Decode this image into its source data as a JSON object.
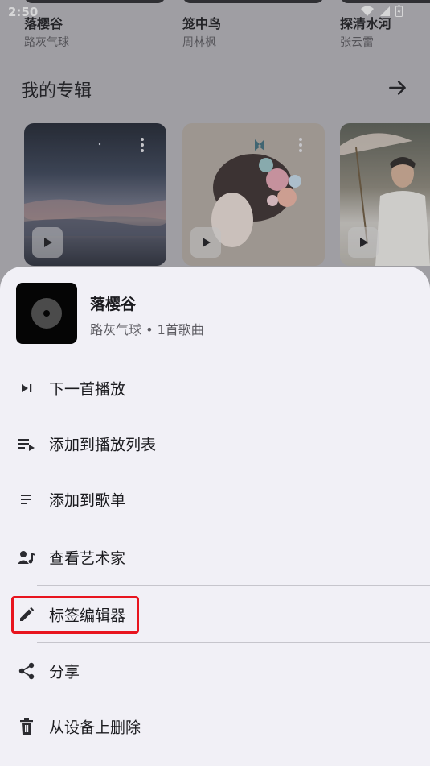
{
  "status_bar": {
    "time": "2:50"
  },
  "top_row": [
    {
      "title": "落樱谷",
      "subtitle": "路灰气球"
    },
    {
      "title": "笼中鸟",
      "subtitle": "周林枫"
    },
    {
      "title": "探清水河",
      "subtitle": "张云雷"
    }
  ],
  "section": {
    "title": "我的专辑"
  },
  "sheet": {
    "title": "落樱谷",
    "subtitle": "路灰气球 • 1首歌曲",
    "menu": [
      {
        "label": "下一首播放",
        "icon": "play-next-icon"
      },
      {
        "label": "添加到播放列表",
        "icon": "queue-add-icon"
      },
      {
        "label": "添加到歌单",
        "icon": "playlist-add-icon"
      },
      {
        "label": "查看艺术家",
        "icon": "artist-icon"
      },
      {
        "label": "标签编辑器",
        "icon": "edit-pencil-icon"
      },
      {
        "label": "分享",
        "icon": "share-icon"
      },
      {
        "label": "从设备上删除",
        "icon": "delete-icon"
      }
    ]
  },
  "colors": {
    "highlight": "#e8141e",
    "sheet_bg": "#f1f0f6",
    "scrim": "#8e8d91"
  }
}
